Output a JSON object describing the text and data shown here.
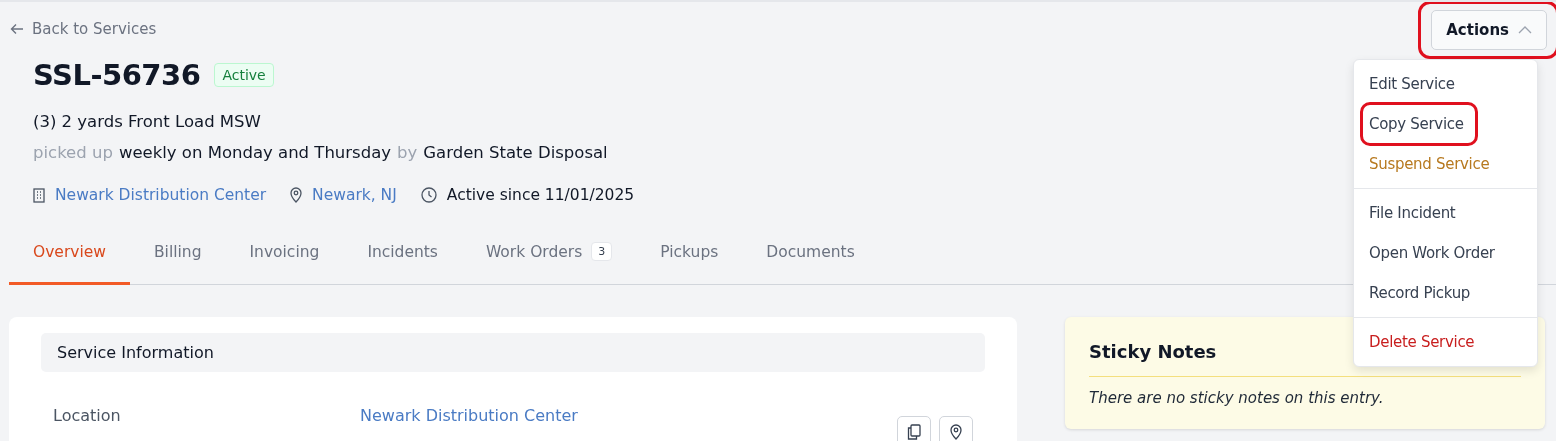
{
  "back_link": {
    "label": "Back to Services"
  },
  "actions_button": {
    "label": "Actions",
    "expanded": true,
    "circled": true
  },
  "actions_menu": {
    "groups": [
      [
        {
          "label": "Edit Service",
          "kind": "normal",
          "circled": false
        },
        {
          "label": "Copy Service",
          "kind": "normal",
          "circled": true
        },
        {
          "label": "Suspend Service",
          "kind": "warning",
          "circled": false
        }
      ],
      [
        {
          "label": "File Incident",
          "kind": "normal",
          "circled": false
        },
        {
          "label": "Open Work Order",
          "kind": "normal",
          "circled": false
        },
        {
          "label": "Record Pickup",
          "kind": "normal",
          "circled": false
        }
      ],
      [
        {
          "label": "Delete Service",
          "kind": "danger",
          "circled": false
        }
      ]
    ]
  },
  "title": "SSL-56736",
  "status_badge": "Active",
  "description": "(3) 2 yards Front Load MSW",
  "schedule": [
    {
      "text": "picked up",
      "kind": "muted"
    },
    {
      "text": "weekly on Monday and Thursday",
      "kind": "value"
    },
    {
      "text": "by",
      "kind": "muted"
    },
    {
      "text": "Garden State Disposal",
      "kind": "value"
    }
  ],
  "meta": [
    {
      "kind": "building",
      "text": "Newark Distribution Center",
      "link": true
    },
    {
      "kind": "pin",
      "text": "Newark, NJ",
      "link": true
    },
    {
      "kind": "clock",
      "text": "Active since 11/01/2025",
      "link": false
    }
  ],
  "tabs": [
    {
      "label": "Overview",
      "selected": true
    },
    {
      "label": "Billing",
      "selected": false
    },
    {
      "label": "Invoicing",
      "selected": false
    },
    {
      "label": "Incidents",
      "selected": false
    },
    {
      "label": "Work Orders",
      "selected": false,
      "count": "3"
    },
    {
      "label": "Pickups",
      "selected": false
    },
    {
      "label": "Documents",
      "selected": false
    }
  ],
  "service_information": {
    "title": "Service Information",
    "rows": [
      {
        "label": "Location",
        "value": "Newark Distribution Center"
      }
    ]
  },
  "sticky_notes": {
    "title": "Sticky Notes",
    "empty_text": "There are no sticky notes on this entry."
  }
}
